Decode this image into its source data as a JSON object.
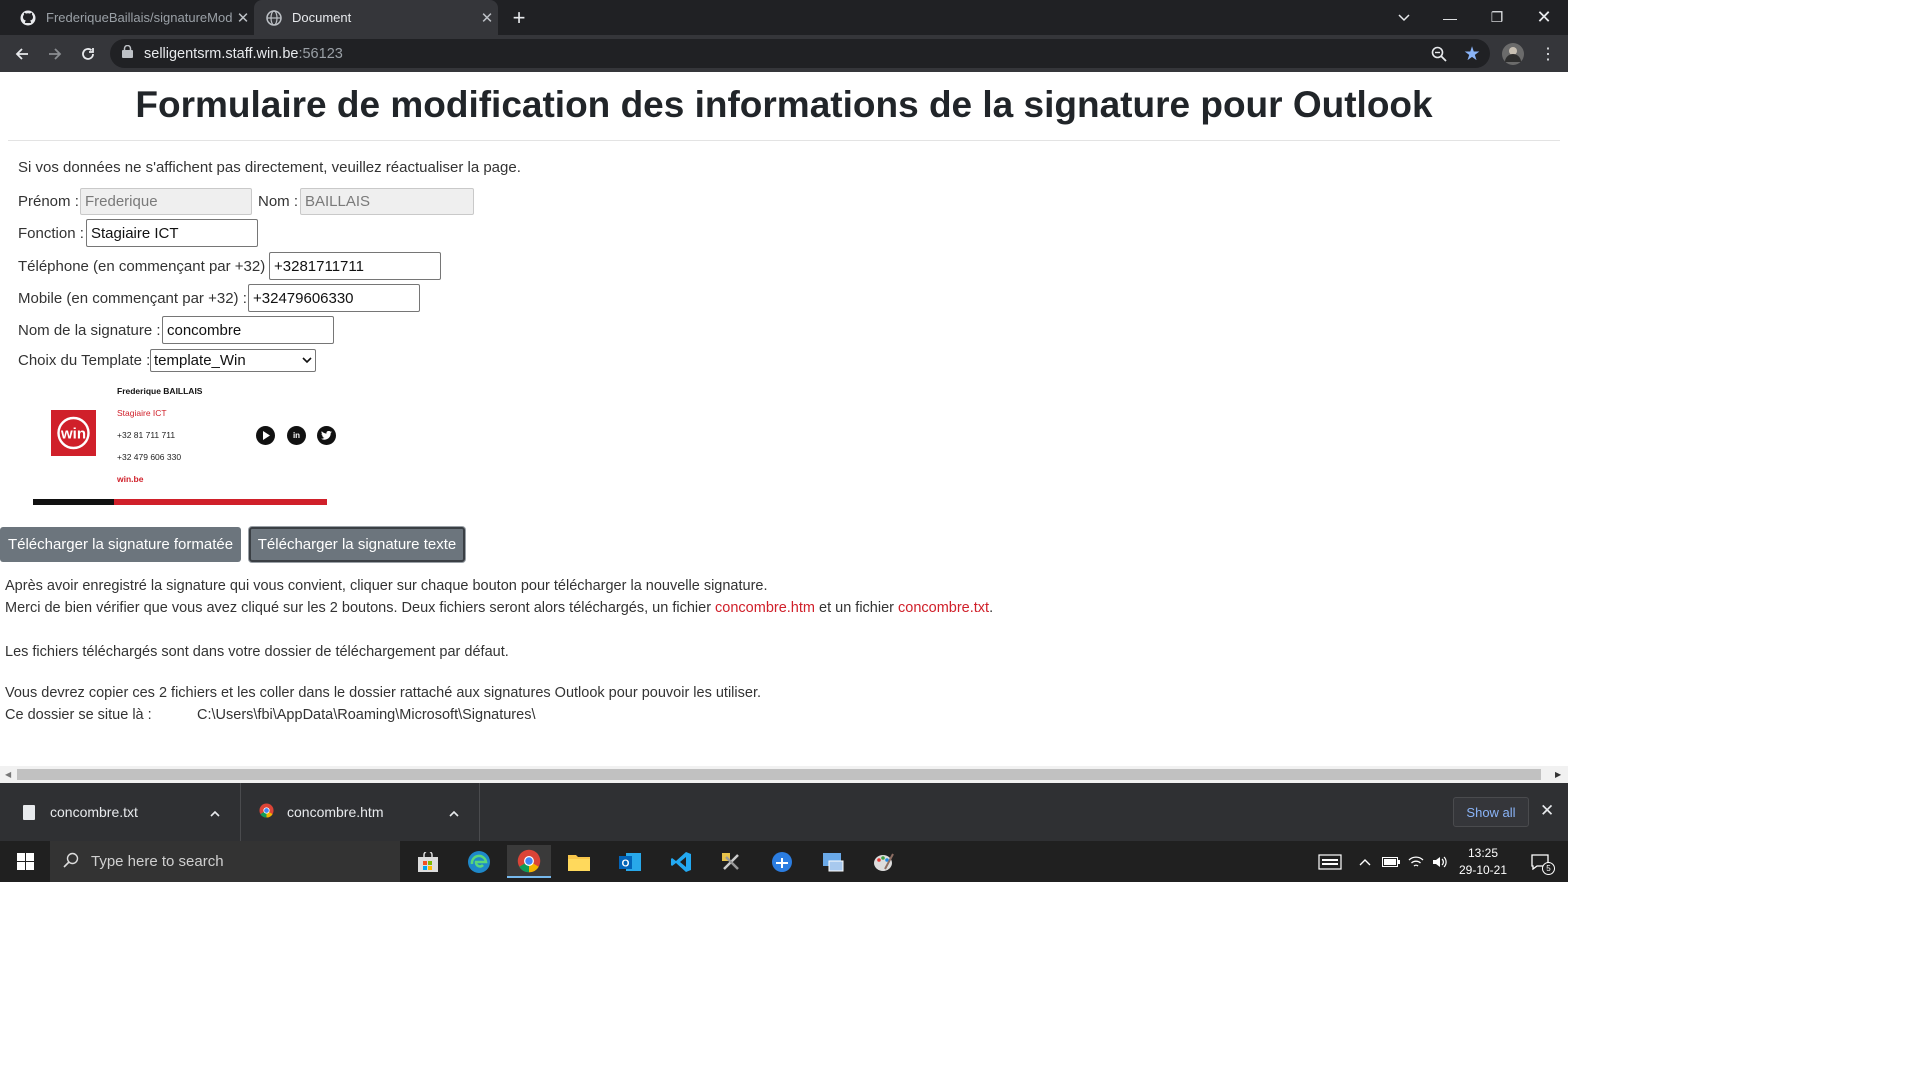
{
  "browser": {
    "tabs": [
      {
        "title": "FrederiqueBaillais/signatureMod",
        "icon": "github-icon"
      },
      {
        "title": "Document",
        "icon": "globe-icon"
      }
    ],
    "url_host": "selligentsrm.staff.win.be",
    "url_port": ":56123"
  },
  "page": {
    "title": "Formulaire de modification des informations de la signature pour Outlook",
    "notice": "Si vos données ne s'affichent pas directement, veuillez réactualiser la page.",
    "form": {
      "prenom_label": "Prénom :",
      "prenom_value": "Frederique",
      "nom_label": "Nom :",
      "nom_value": "BAILLAIS",
      "fonction_label": "Fonction :",
      "fonction_value": "Stagiaire ICT",
      "telephone_label": "Téléphone (en commençant par +32) :",
      "telephone_value": "+3281711711",
      "mobile_label": "Mobile (en commençant par +32) :",
      "mobile_value": "+32479606330",
      "signame_label": "Nom de la signature :",
      "signame_value": "concombre",
      "template_label": "Choix du Template :",
      "template_value": "template_Win"
    },
    "signature": {
      "logo_text": "win",
      "name": "Frederique BAILLAIS",
      "function": "Stagiaire ICT",
      "phone": "+32 81 711 711",
      "mobile": "+32 479 606 330",
      "website": "win.be"
    },
    "buttons": {
      "formatted": "Télécharger la signature formatée",
      "text": "Télécharger la signature texte"
    },
    "instructions": {
      "line1": "Après avoir enregistré la signature qui vous convient, cliquer sur chaque bouton pour télécharger la nouvelle signature.",
      "line2_a": "Merci de bien vérifier que vous avez cliqué sur les 2 boutons. Deux fichiers seront alors téléchargés, un fichier ",
      "line2_file1": "concombre.htm",
      "line2_mid": " et un fichier ",
      "line2_file2": "concombre.txt",
      "line2_end": ".",
      "line3": "Les fichiers téléchargés sont dans votre dossier de téléchargement par défaut.",
      "line4": "Vous devrez copier ces 2 fichiers et les coller dans le dossier rattaché aux signatures Outlook pour pouvoir les utiliser.",
      "line5": "Ce dossier se situe là :",
      "path": "C:\\Users\\fbi\\AppData\\Roaming\\Microsoft\\Signatures\\"
    }
  },
  "downloads": {
    "items": [
      {
        "name": "concombre.txt"
      },
      {
        "name": "concombre.htm"
      }
    ],
    "show_all": "Show all"
  },
  "taskbar": {
    "search_placeholder": "Type here to search",
    "time": "13:25",
    "date": "29-10-21",
    "notifications": "5"
  },
  "colors": {
    "accent_red": "#d0202a",
    "button_gray": "#6c757d"
  }
}
